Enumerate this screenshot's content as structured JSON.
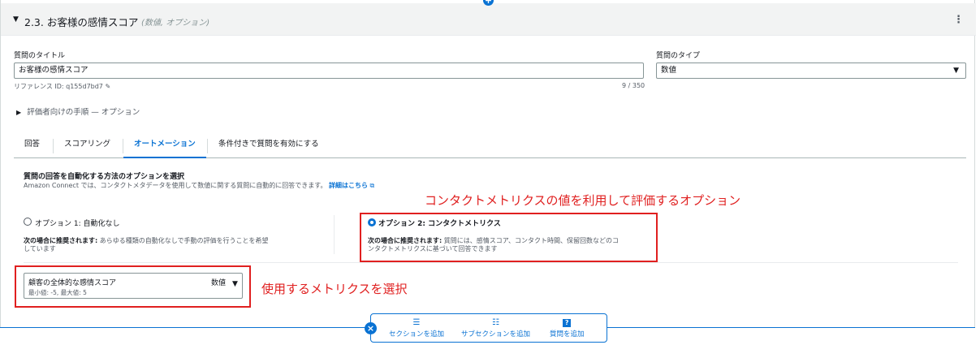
{
  "section": {
    "title": "2.3. お客様の感情スコア",
    "subtitle": "(数値, オプション)"
  },
  "question_title": {
    "label": "質問のタイトル",
    "value": "お客様の感情スコア",
    "reference": "リファレンス ID: q155d7bd7",
    "char_count": "9 / 350"
  },
  "question_type": {
    "label": "質問のタイプ",
    "value": "数値"
  },
  "evaluator_instructions": "評価者向けの手順 — オプション",
  "tabs": [
    {
      "label": "回答"
    },
    {
      "label": "スコアリング"
    },
    {
      "label": "オートメーション"
    },
    {
      "label": "条件付きで質問を有効にする"
    }
  ],
  "automation": {
    "heading": "質問の回答を自動化する方法のオプションを選択",
    "description": "Amazon Connect では、コンタクトメタデータを使用して数値に関する質問に自動的に回答できます。",
    "learn_more": "詳細はこちら",
    "option1": {
      "label": "オプション 1: 自動化なし",
      "rec_bold": "次の場合に推奨されます:",
      "rec_text_1": "あらゆる種類の自動化なしで手動の評価を行うことを希望",
      "rec_text_2": "しています"
    },
    "option2": {
      "label": "オプション 2: コンタクトメトリクス",
      "rec_bold": "次の場合に推奨されます:",
      "rec_text_1": "質問には、感情スコア、コンタクト時間、保留回数などのコ",
      "rec_text_2": "ンタクトメトリクスに基づいて回答できます"
    },
    "metric_select": {
      "value": "顧客の全体的な感情スコア",
      "type": "数値",
      "range": "最小値: -5, 最大値: 5"
    }
  },
  "annotations": {
    "contact_metrics": "コンタクトメトリクスの値を利用して評価するオプション",
    "select_metric": "使用するメトリクスを選択"
  },
  "bottom_bar": {
    "add_section": "セクションを追加",
    "add_subsection": "サブセクションを追加",
    "add_question": "質問を追加"
  },
  "colors": {
    "accent": "#0972d3",
    "annotation": "#e02020"
  }
}
